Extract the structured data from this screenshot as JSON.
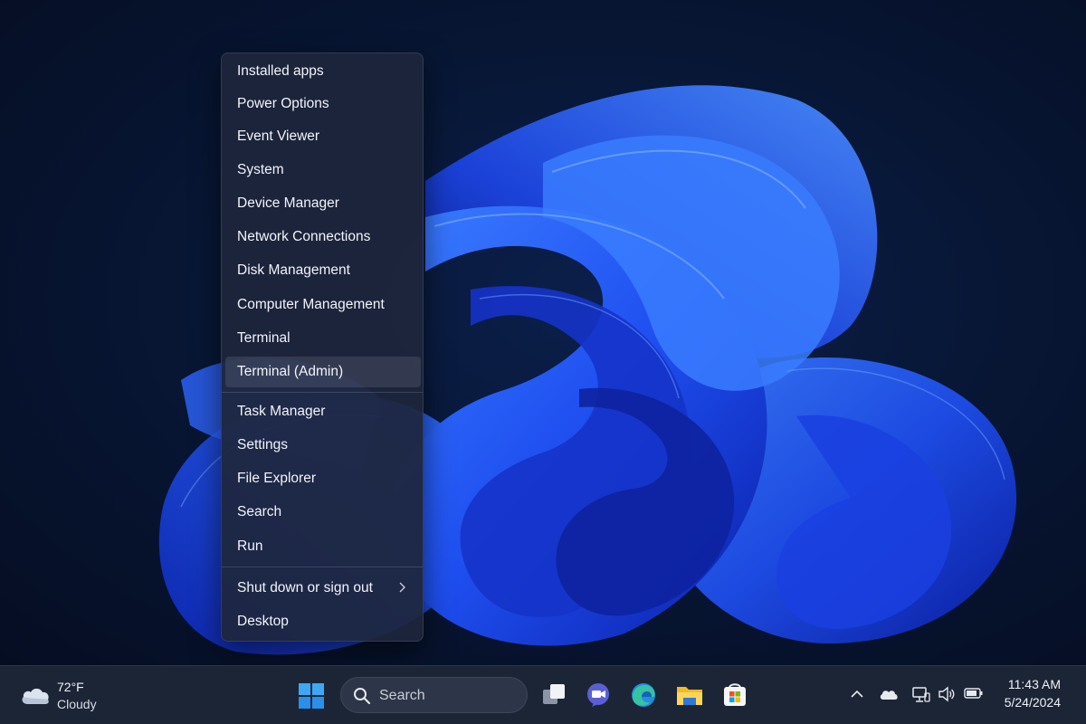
{
  "menu": {
    "items": [
      {
        "label": "Installed apps"
      },
      {
        "label": "Power Options"
      },
      {
        "label": "Event Viewer"
      },
      {
        "label": "System"
      },
      {
        "label": "Device Manager"
      },
      {
        "label": "Network Connections"
      },
      {
        "label": "Disk Management"
      },
      {
        "label": "Computer Management"
      },
      {
        "label": "Terminal"
      },
      {
        "label": "Terminal (Admin)",
        "selected": true
      },
      {
        "label": "Task Manager"
      },
      {
        "label": "Settings"
      },
      {
        "label": "File Explorer"
      },
      {
        "label": "Search"
      },
      {
        "label": "Run"
      },
      {
        "label": "Shut down or sign out",
        "has_submenu": true
      },
      {
        "label": "Desktop"
      }
    ]
  },
  "taskbar": {
    "weather": {
      "temp": "72°F",
      "condition": "Cloudy",
      "icon": "cloud-icon"
    },
    "search": {
      "label": "Search"
    },
    "apps": [
      {
        "name": "task-view",
        "icon": "task-view-icon"
      },
      {
        "name": "teams-meet",
        "icon": "meet-icon"
      },
      {
        "name": "edge",
        "icon": "edge-icon"
      },
      {
        "name": "file-explorer",
        "icon": "folder-icon"
      },
      {
        "name": "store",
        "icon": "store-icon"
      }
    ],
    "tray": {
      "icons": [
        "chevron-up-icon",
        "onedrive-icon",
        "network-icon",
        "volume-icon",
        "battery-icon"
      ]
    },
    "clock": {
      "time": "11:43 AM",
      "date": "5/24/2024"
    }
  },
  "colors": {
    "accent": "#2c63ff",
    "taskbar": "#1c2536",
    "menu": "#1e263c"
  }
}
